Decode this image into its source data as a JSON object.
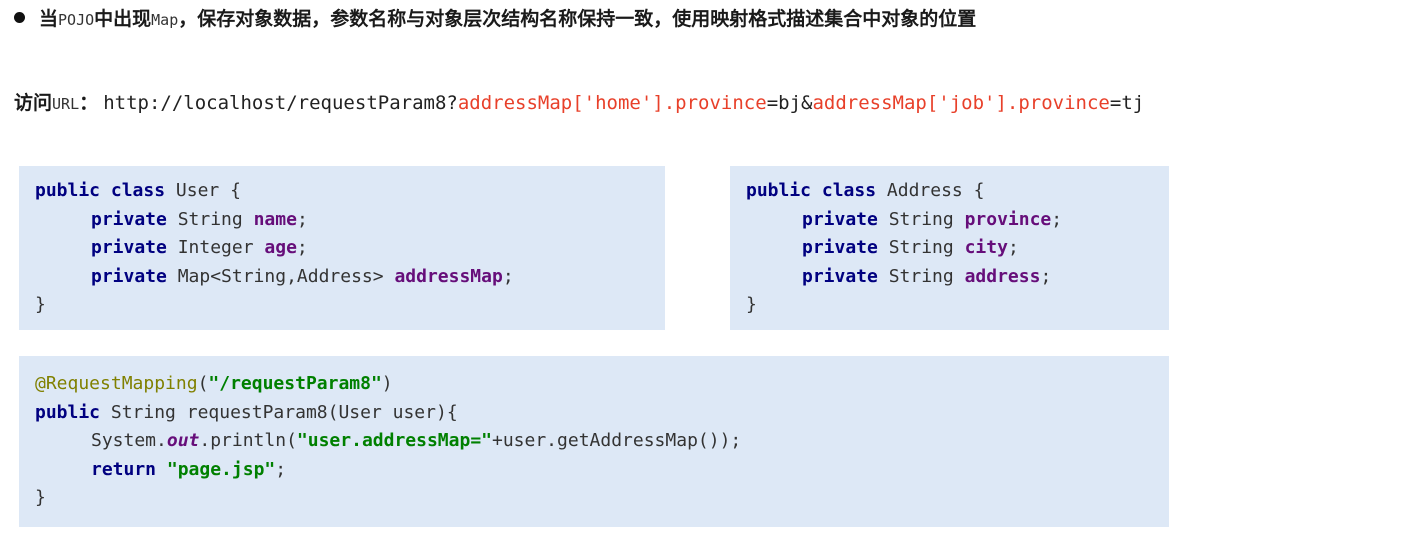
{
  "bullet": {
    "prefix": "当",
    "pojo": "POJO",
    "mid": "中出现",
    "map": "Map",
    "rest": "，保存对象数据，参数名称与对象层次结构名称保持一致，使用映射格式描述集合中对象的位置"
  },
  "access": {
    "label_cn": "访问",
    "label_url": "URL",
    "colon": "：",
    "url_base": "http://localhost/requestParam8?",
    "param1": "addressMap['home'].province",
    "eq1": "=bj&",
    "param2": "addressMap['job'].province",
    "eq2": "=tj"
  },
  "user_class": {
    "kw_public": "public",
    "kw_class": "class",
    "name": "User",
    "open": "{",
    "kw_private": "private",
    "f1_type": "String",
    "f1_name": "name",
    "f2_type": "Integer",
    "f2_name": "age",
    "f3_type": "Map<String,Address>",
    "f3_name": "addressMap",
    "semi": ";",
    "close": "}"
  },
  "address_class": {
    "kw_public": "public",
    "kw_class": "class",
    "name": "Address",
    "open": "{",
    "kw_private": "private",
    "f_type": "String",
    "f1_name": "province",
    "f2_name": "city",
    "f3_name": "address",
    "semi": ";",
    "close": "}"
  },
  "method": {
    "annotation": "@RequestMapping",
    "ann_open": "(",
    "ann_value": "\"/requestParam8\"",
    "ann_close": ")",
    "kw_public": "public",
    "sig": "String requestParam8(User user){",
    "print_pre": "System.",
    "print_out": "out",
    "print_mid": ".println(",
    "print_str": "\"user.addressMap=\"",
    "print_post": "+user.getAddressMap());",
    "kw_return": "return",
    "return_val": "\"page.jsp\"",
    "semi": ";",
    "close": "}"
  }
}
